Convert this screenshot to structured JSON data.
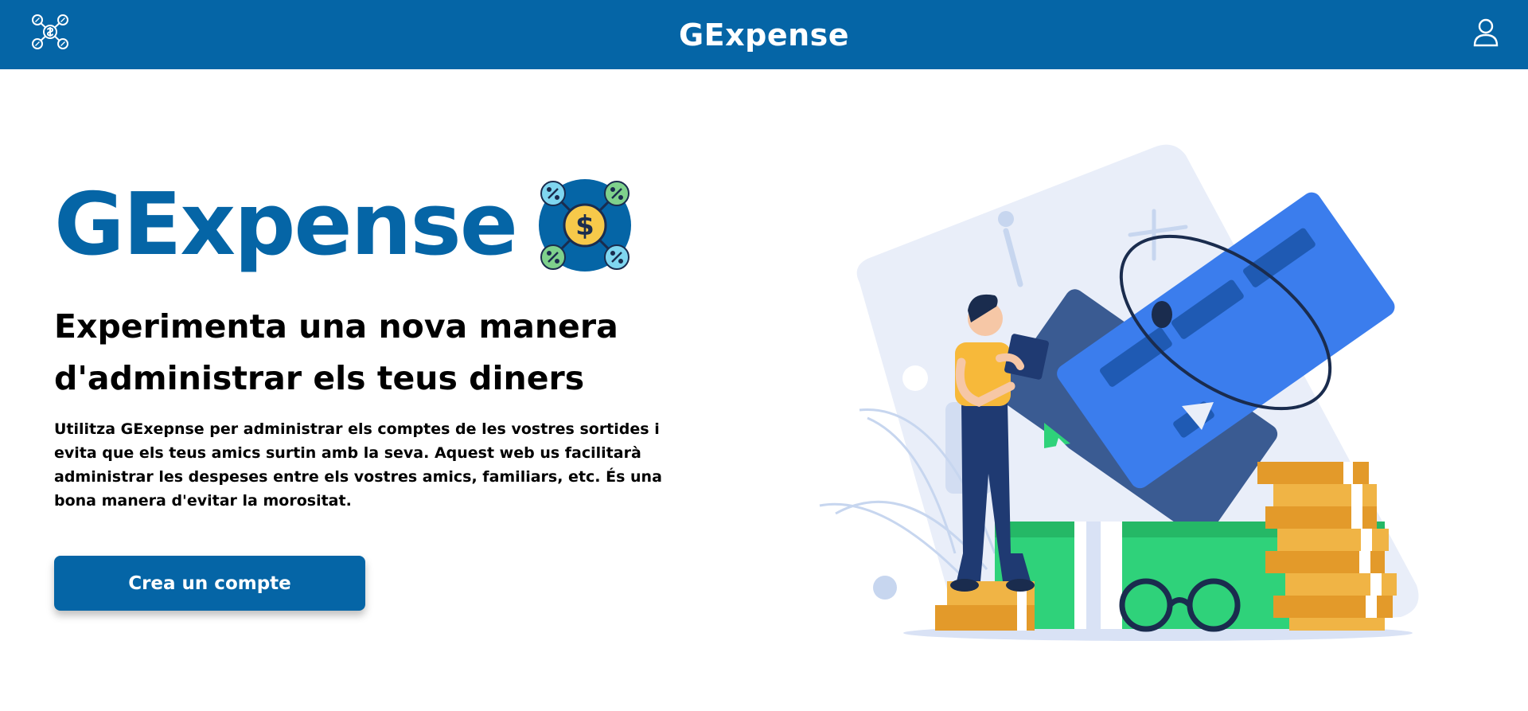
{
  "header": {
    "logo_icon": "network-dollar-icon",
    "app_title": "GExpense",
    "user_icon": "user-icon",
    "background_color": "#0565a6"
  },
  "hero": {
    "title": "GExpense",
    "title_logo_icon": "dollar-network-logo-icon",
    "subtitle_line1": "Experimenta una nova manera",
    "subtitle_line2": "d'administrar els teus diners",
    "description": "Utilitza GExepnse per administrar els comptes de les vostres sortides i evita que els teus amics surtin amb la seva. Aquest web us facilitarà administrar les despeses entre els vostres amics, familiars, etc. És una bona manera d'evitar la morositat.",
    "cta_label": "Crea un compte",
    "illustration": "person-with-credit-card-and-coins-illustration"
  },
  "colors": {
    "brand": "#0565a6",
    "card": "#3b7ded",
    "money_green": "#2fd27a",
    "coin_gold": "#f0a93a"
  }
}
